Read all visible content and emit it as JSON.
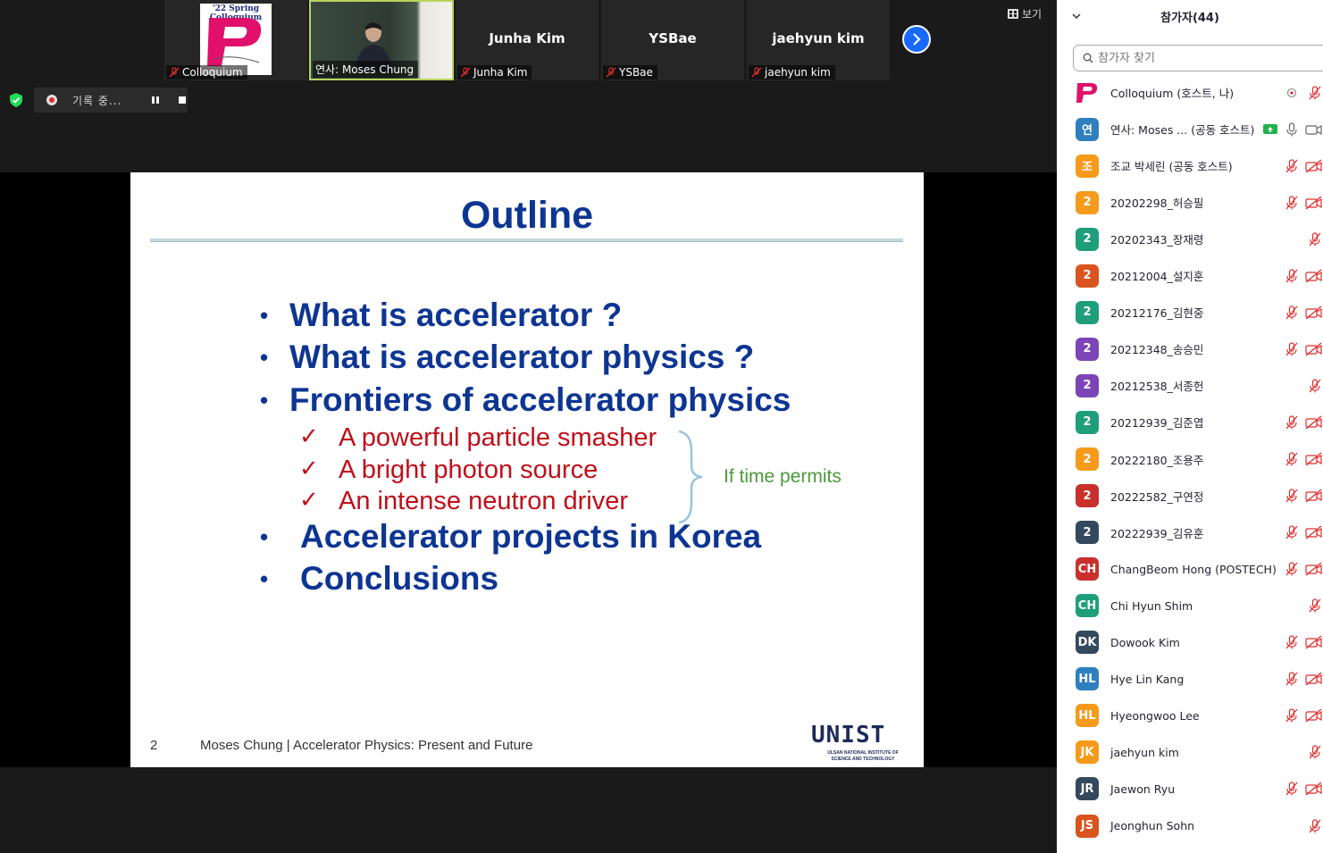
{
  "thumbnails": [
    {
      "name_tag": "Colloquium",
      "label_center": "",
      "type": "logo",
      "logo_text": "'22 Spring Colloquium"
    },
    {
      "name_tag": "연사: Moses Chung",
      "label_center": "",
      "type": "camera"
    },
    {
      "name_tag": "Junha Kim",
      "label_center": "Junha Kim",
      "type": "name"
    },
    {
      "name_tag": "YSBae",
      "label_center": "YSBae",
      "type": "name"
    },
    {
      "name_tag": "jaehyun kim",
      "label_center": "jaehyun kim",
      "type": "name"
    }
  ],
  "view_button": {
    "label": "보기",
    "icon": "grid-icon"
  },
  "next_icon": "chevron-right-icon",
  "recording": {
    "label": "기록 중...",
    "shield_color": "#23d959"
  },
  "slide": {
    "title": "Outline",
    "bullets": [
      "What is accelerator ?",
      "What is accelerator physics ?",
      "Frontiers of accelerator physics",
      "Accelerator projects in Korea",
      "Conclusions"
    ],
    "sub_items": [
      "A powerful particle smasher",
      "A bright photon source",
      "An intense neutron driver"
    ],
    "check_glyph": "✓",
    "brace_note": "If time permits",
    "page_number": "2",
    "footer": "Moses Chung | Accelerator Physics: Present and Future",
    "logo_text": "UNIST",
    "logo_subtext": "ULSAN NATIONAL INSTITUTE OF SCIENCE AND TECHNOLOGY",
    "colors": {
      "title": "#0d3592",
      "sub": "#c00f1a",
      "note": "#4a9a3a"
    }
  },
  "participants_panel": {
    "title": "참가자(44)",
    "search_placeholder": "참가자 찾기",
    "participants": [
      {
        "initials": "P",
        "name": "Colloquium (호스트, 나)",
        "color": "#ffffff",
        "logo": true,
        "mic": "share",
        "cam": "muted-mic"
      },
      {
        "initials": "연",
        "name": "연사: Moses ... (공동 호스트)",
        "color": "#2f7fbf",
        "badge": "share-icon",
        "mic": "on",
        "cam": "on"
      },
      {
        "initials": "조",
        "name": "조교 박세린 (공동 호스트)",
        "color": "#f59a1b",
        "mic": "off",
        "cam": "off"
      },
      {
        "initials": "2",
        "name": "20202298_허승필",
        "color": "#f59a1b",
        "mic": "off",
        "cam": "off"
      },
      {
        "initials": "2",
        "name": "20202343_장재령",
        "color": "#1f9e7a",
        "mic": "none",
        "cam": "off-only"
      },
      {
        "initials": "2",
        "name": "20212004_설지훈",
        "color": "#d9541e",
        "mic": "off",
        "cam": "off"
      },
      {
        "initials": "2",
        "name": "20212176_김현중",
        "color": "#1f9e7a",
        "mic": "off",
        "cam": "off"
      },
      {
        "initials": "2",
        "name": "20212348_송승민",
        "color": "#7b45b8",
        "mic": "off",
        "cam": "off"
      },
      {
        "initials": "2",
        "name": "20212538_서종헌",
        "color": "#7b45b8",
        "mic": "none",
        "cam": "off-only"
      },
      {
        "initials": "2",
        "name": "20212939_김준엽",
        "color": "#1f9e7a",
        "mic": "off",
        "cam": "off"
      },
      {
        "initials": "2",
        "name": "20222180_조용주",
        "color": "#f59a1b",
        "mic": "off",
        "cam": "off"
      },
      {
        "initials": "2",
        "name": "20222582_구연정",
        "color": "#c9302c",
        "mic": "off",
        "cam": "off"
      },
      {
        "initials": "2",
        "name": "20222939_김유훈",
        "color": "#34495e",
        "mic": "off",
        "cam": "off"
      },
      {
        "initials": "CH",
        "name": "ChangBeom Hong (POSTECH)",
        "color": "#c9302c",
        "mic": "off",
        "cam": "off"
      },
      {
        "initials": "CH",
        "name": "Chi Hyun Shim",
        "color": "#1f9e7a",
        "mic": "none",
        "cam": "off-only"
      },
      {
        "initials": "DK",
        "name": "Dowook Kim",
        "color": "#34495e",
        "mic": "off",
        "cam": "off"
      },
      {
        "initials": "HL",
        "name": "Hye Lin Kang",
        "color": "#2f7fbf",
        "mic": "off",
        "cam": "off"
      },
      {
        "initials": "HL",
        "name": "Hyeongwoo Lee",
        "color": "#f59a1b",
        "mic": "off",
        "cam": "off"
      },
      {
        "initials": "JK",
        "name": "jaehyun kim",
        "color": "#f59a1b",
        "mic": "none",
        "cam": "off-only"
      },
      {
        "initials": "JR",
        "name": "Jaewon Ryu",
        "color": "#34495e",
        "mic": "off",
        "cam": "off"
      },
      {
        "initials": "JS",
        "name": "Jeonghun Sohn",
        "color": "#d9541e",
        "mic": "none",
        "cam": "off-only"
      }
    ]
  }
}
